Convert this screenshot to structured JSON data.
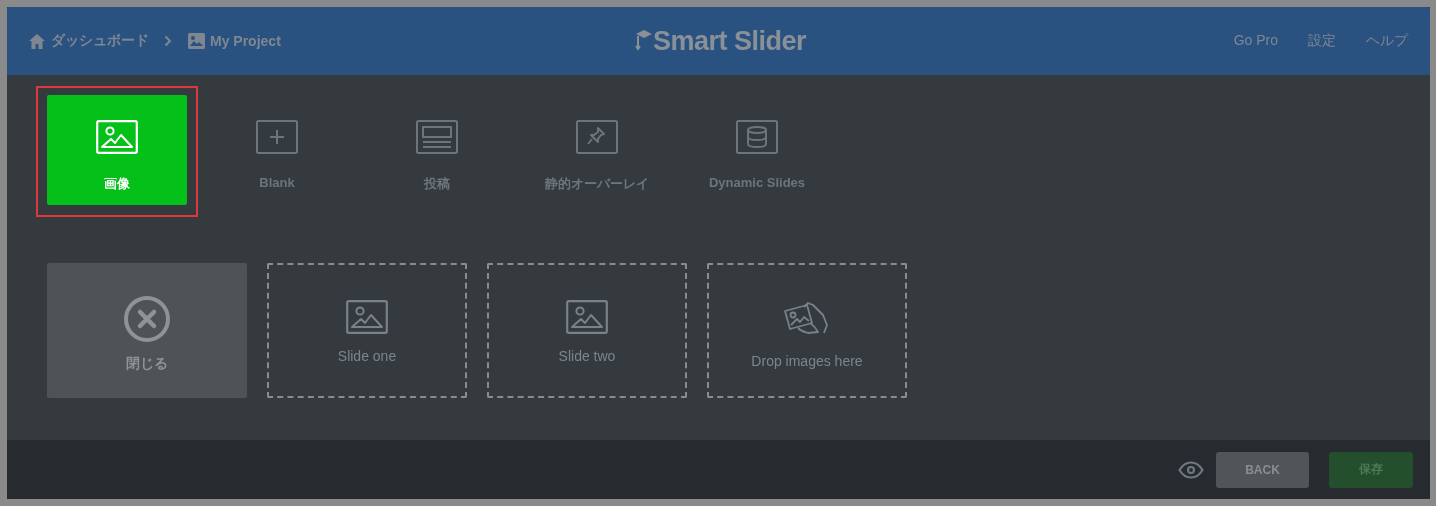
{
  "header": {
    "breadcrumbs": [
      {
        "label": "ダッシュボード",
        "kind": "home"
      },
      {
        "label": "My Project",
        "kind": "project"
      }
    ],
    "logo": "Smart Slider",
    "links": [
      "Go Pro",
      "設定",
      "ヘルプ"
    ]
  },
  "slide_types": [
    {
      "label": "画像",
      "kind": "image",
      "selected": true
    },
    {
      "label": "Blank",
      "kind": "blank",
      "selected": false
    },
    {
      "label": "投稿",
      "kind": "post",
      "selected": false
    },
    {
      "label": "静的オーバーレイ",
      "kind": "pin",
      "selected": false
    },
    {
      "label": "Dynamic Slides",
      "kind": "database",
      "selected": false
    }
  ],
  "slides": [
    {
      "label": "閉じる",
      "kind": "close"
    },
    {
      "label": "Slide one",
      "kind": "slide"
    },
    {
      "label": "Slide two",
      "kind": "slide"
    },
    {
      "label": "Drop images here",
      "kind": "drop"
    }
  ],
  "footer": {
    "buttons": [
      {
        "label": "BACK",
        "kind": "back"
      },
      {
        "label": "保存",
        "kind": "save"
      }
    ]
  }
}
